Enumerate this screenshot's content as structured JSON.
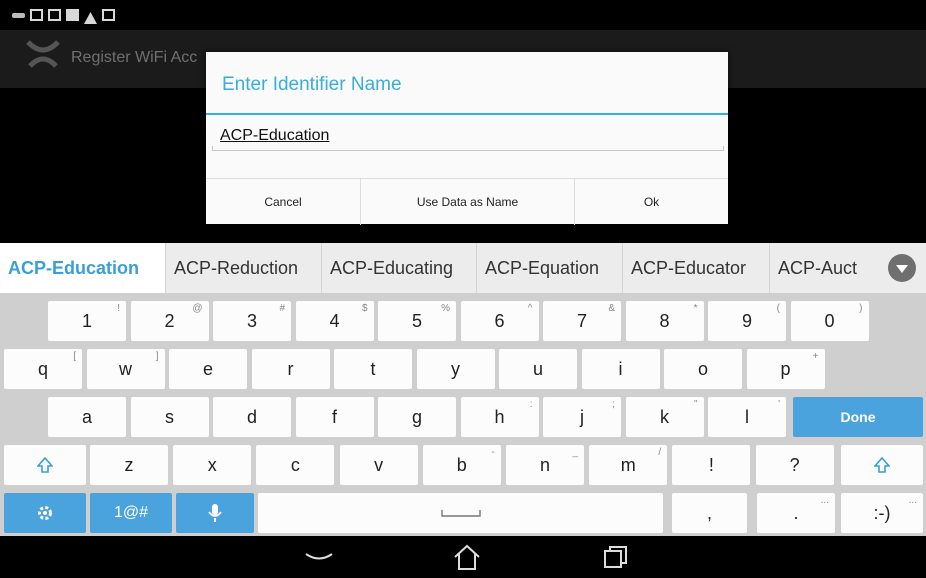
{
  "app_bar": {
    "title": "Register WiFi Acc"
  },
  "dialog": {
    "title": "Enter Identifier Name",
    "input_value": "ACP-Education",
    "buttons": {
      "cancel": "Cancel",
      "use_data": "Use Data as Name",
      "ok": "Ok"
    }
  },
  "suggestions": [
    "ACP-Education",
    "ACP-Reduction",
    "ACP-Educating",
    "ACP-Equation",
    "ACP-Educator",
    "ACP-Auct"
  ],
  "keyboard": {
    "number_row": [
      {
        "key": "1",
        "hint": "!"
      },
      {
        "key": "2",
        "hint": "@"
      },
      {
        "key": "3",
        "hint": "#"
      },
      {
        "key": "4",
        "hint": "$"
      },
      {
        "key": "5",
        "hint": "%"
      },
      {
        "key": "6",
        "hint": "^"
      },
      {
        "key": "7",
        "hint": "&"
      },
      {
        "key": "8",
        "hint": "*"
      },
      {
        "key": "9",
        "hint": "("
      },
      {
        "key": "0",
        "hint": ")"
      }
    ],
    "row_q": [
      {
        "key": "q",
        "hint": "["
      },
      {
        "key": "w",
        "hint": "]"
      },
      {
        "key": "e",
        "hint": ""
      },
      {
        "key": "r",
        "hint": ""
      },
      {
        "key": "t",
        "hint": ""
      },
      {
        "key": "y",
        "hint": ""
      },
      {
        "key": "u",
        "hint": ""
      },
      {
        "key": "i",
        "hint": ""
      },
      {
        "key": "o",
        "hint": ""
      },
      {
        "key": "p",
        "hint": "+"
      }
    ],
    "row_a": [
      {
        "key": "a",
        "hint": ""
      },
      {
        "key": "s",
        "hint": ""
      },
      {
        "key": "d",
        "hint": ""
      },
      {
        "key": "f",
        "hint": ""
      },
      {
        "key": "g",
        "hint": ""
      },
      {
        "key": "h",
        "hint": ":"
      },
      {
        "key": "j",
        "hint": ";"
      },
      {
        "key": "k",
        "hint": "\""
      },
      {
        "key": "l",
        "hint": "'"
      }
    ],
    "row_z": [
      {
        "key": "z",
        "hint": ""
      },
      {
        "key": "x",
        "hint": ""
      },
      {
        "key": "c",
        "hint": ""
      },
      {
        "key": "v",
        "hint": ""
      },
      {
        "key": "b",
        "hint": "-"
      },
      {
        "key": "n",
        "hint": "_"
      },
      {
        "key": "m",
        "hint": "/"
      },
      {
        "key": "!",
        "hint": ""
      },
      {
        "key": "?",
        "hint": ""
      }
    ],
    "done_label": "Done",
    "symbols_label": "1@#",
    "comma_label": ",",
    "period_label": ".",
    "smiley_label": ":-)",
    "more_hint": "...",
    "accent_color": "#4aa3dc"
  },
  "icons": {
    "status": [
      "usb-icon",
      "screenshot-icon",
      "gallery-icon",
      "sim-icon",
      "warning-icon",
      "download-icon"
    ],
    "nav": [
      "back-icon",
      "home-icon",
      "recents-icon"
    ]
  }
}
